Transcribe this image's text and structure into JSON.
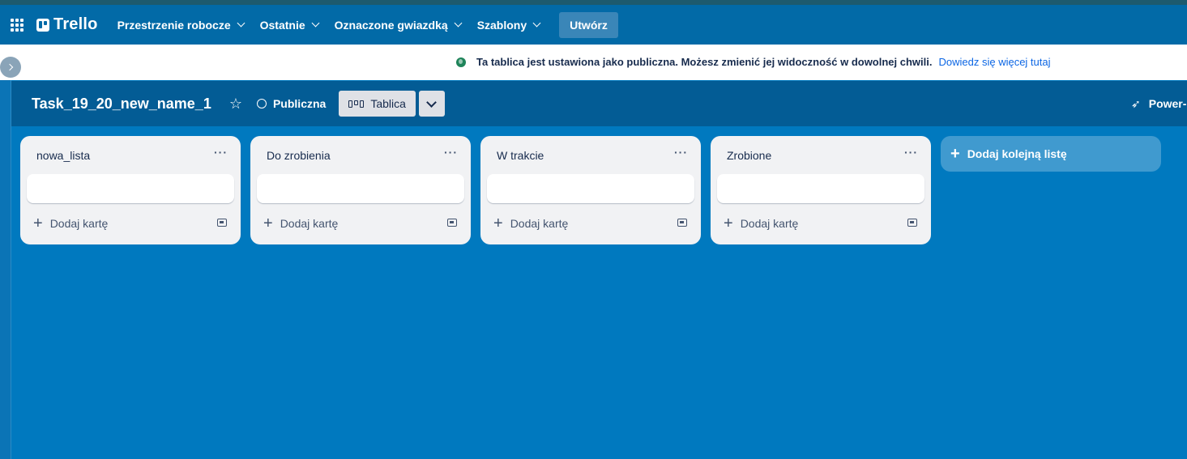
{
  "topnav": {
    "logo": "Trello",
    "menu": [
      {
        "label": "Przestrzenie robocze"
      },
      {
        "label": "Ostatnie"
      },
      {
        "label": "Oznaczone gwiazdką"
      },
      {
        "label": "Szablony"
      }
    ],
    "create_label": "Utwórz"
  },
  "banner": {
    "text": "Ta tablica jest ustawiona jako publiczna. Możesz zmienić jej widoczność w dowolnej chwili.",
    "link": "Dowiedz się więcej tutaj"
  },
  "board": {
    "title": "Task_19_20_new_name_1",
    "visibility": "Publiczna",
    "view": "Tablica",
    "powerups": "Power-"
  },
  "lists": [
    {
      "title": "nowa_lista",
      "add_card": "Dodaj kartę"
    },
    {
      "title": "Do zrobienia",
      "add_card": "Dodaj kartę"
    },
    {
      "title": "W trakcie",
      "add_card": "Dodaj kartę"
    },
    {
      "title": "Zrobione",
      "add_card": "Dodaj kartę"
    }
  ],
  "add_list_label": "Dodaj kolejną listę",
  "icons": {
    "apps": "apps-grid-icon",
    "star": "star-icon",
    "globe": "globe-icon",
    "menu": "more-horizontal-icon",
    "template": "card-template-icon",
    "rocket": "rocket-icon"
  },
  "colors": {
    "board_bg": "#0079bf",
    "nav_bg": "#026aa7",
    "header_bg": "#035c95",
    "list_bg": "#f1f2f4"
  }
}
